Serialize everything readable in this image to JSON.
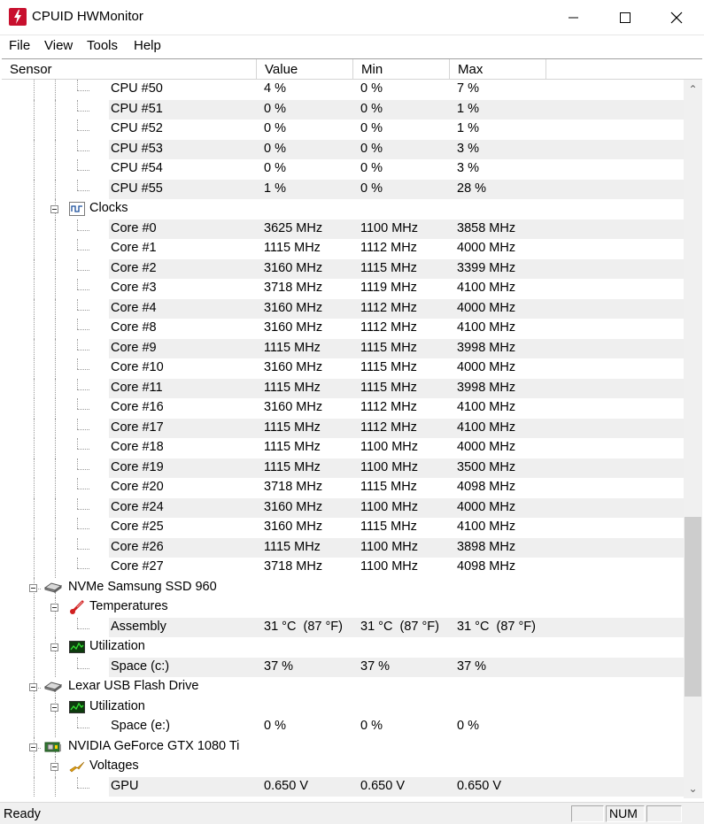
{
  "window": {
    "title": "CPUID HWMonitor"
  },
  "menu": [
    "File",
    "View",
    "Tools",
    "Help"
  ],
  "columns": [
    "Sensor",
    "Value",
    "Min",
    "Max"
  ],
  "tree_rows": [
    {
      "kind": "leaf",
      "name": "CPU #50",
      "value": "4 %",
      "min": "0 %",
      "max": "7 %"
    },
    {
      "kind": "leaf",
      "name": "CPU #51",
      "value": "0 %",
      "min": "0 %",
      "max": "1 %"
    },
    {
      "kind": "leaf",
      "name": "CPU #52",
      "value": "0 %",
      "min": "0 %",
      "max": "1 %"
    },
    {
      "kind": "leaf",
      "name": "CPU #53",
      "value": "0 %",
      "min": "0 %",
      "max": "3 %"
    },
    {
      "kind": "leaf",
      "name": "CPU #54",
      "value": "0 %",
      "min": "0 %",
      "max": "3 %"
    },
    {
      "kind": "leaf",
      "name": "CPU #55",
      "value": "1 %",
      "min": "0 %",
      "max": "28 %"
    },
    {
      "kind": "group",
      "name": "Clocks",
      "icon": "clock-wave-icon"
    },
    {
      "kind": "leaf",
      "name": "Core #0",
      "value": "3625 MHz",
      "min": "1100 MHz",
      "max": "3858 MHz"
    },
    {
      "kind": "leaf",
      "name": "Core #1",
      "value": "1115 MHz",
      "min": "1112 MHz",
      "max": "4000 MHz"
    },
    {
      "kind": "leaf",
      "name": "Core #2",
      "value": "3160 MHz",
      "min": "1115 MHz",
      "max": "3399 MHz"
    },
    {
      "kind": "leaf",
      "name": "Core #3",
      "value": "3718 MHz",
      "min": "1119 MHz",
      "max": "4100 MHz"
    },
    {
      "kind": "leaf",
      "name": "Core #4",
      "value": "3160 MHz",
      "min": "1112 MHz",
      "max": "4000 MHz"
    },
    {
      "kind": "leaf",
      "name": "Core #8",
      "value": "3160 MHz",
      "min": "1112 MHz",
      "max": "4100 MHz"
    },
    {
      "kind": "leaf",
      "name": "Core #9",
      "value": "1115 MHz",
      "min": "1115 MHz",
      "max": "3998 MHz"
    },
    {
      "kind": "leaf",
      "name": "Core #10",
      "value": "3160 MHz",
      "min": "1115 MHz",
      "max": "4000 MHz"
    },
    {
      "kind": "leaf",
      "name": "Core #11",
      "value": "1115 MHz",
      "min": "1115 MHz",
      "max": "3998 MHz"
    },
    {
      "kind": "leaf",
      "name": "Core #16",
      "value": "3160 MHz",
      "min": "1112 MHz",
      "max": "4100 MHz"
    },
    {
      "kind": "leaf",
      "name": "Core #17",
      "value": "1115 MHz",
      "min": "1112 MHz",
      "max": "4100 MHz"
    },
    {
      "kind": "leaf",
      "name": "Core #18",
      "value": "1115 MHz",
      "min": "1100 MHz",
      "max": "4000 MHz"
    },
    {
      "kind": "leaf",
      "name": "Core #19",
      "value": "1115 MHz",
      "min": "1100 MHz",
      "max": "3500 MHz"
    },
    {
      "kind": "leaf",
      "name": "Core #20",
      "value": "3718 MHz",
      "min": "1115 MHz",
      "max": "4098 MHz"
    },
    {
      "kind": "leaf",
      "name": "Core #24",
      "value": "3160 MHz",
      "min": "1100 MHz",
      "max": "4000 MHz"
    },
    {
      "kind": "leaf",
      "name": "Core #25",
      "value": "3160 MHz",
      "min": "1115 MHz",
      "max": "4100 MHz"
    },
    {
      "kind": "leaf",
      "name": "Core #26",
      "value": "1115 MHz",
      "min": "1100 MHz",
      "max": "3898 MHz"
    },
    {
      "kind": "leaf",
      "name": "Core #27",
      "value": "3718 MHz",
      "min": "1100 MHz",
      "max": "4098 MHz"
    },
    {
      "kind": "device",
      "name": "NVMe Samsung SSD 960",
      "icon": "drive-icon"
    },
    {
      "kind": "group",
      "name": "Temperatures",
      "icon": "thermometer-icon"
    },
    {
      "kind": "leaf",
      "name": "Assembly",
      "value": "31 °C  (87 °F)",
      "min": "31 °C  (87 °F)",
      "max": "31 °C  (87 °F)"
    },
    {
      "kind": "group",
      "name": "Utilization",
      "icon": "utilization-monitor-icon"
    },
    {
      "kind": "leaf",
      "name": "Space (c:)",
      "value": "37 %",
      "min": "37 %",
      "max": "37 %"
    },
    {
      "kind": "device",
      "name": "Lexar USB Flash Drive",
      "icon": "drive-icon"
    },
    {
      "kind": "group",
      "name": "Utilization",
      "icon": "utilization-monitor-icon"
    },
    {
      "kind": "leaf",
      "name": "Space (e:)",
      "value": "0 %",
      "min": "0 %",
      "max": "0 %"
    },
    {
      "kind": "device",
      "name": "NVIDIA GeForce GTX 1080 Ti",
      "icon": "gpu-card-icon"
    },
    {
      "kind": "group",
      "name": "Voltages",
      "icon": "voltage-bolt-icon"
    },
    {
      "kind": "leaf",
      "name": "GPU",
      "value": "0.650 V",
      "min": "0.650 V",
      "max": "0.650 V"
    }
  ],
  "statusbar": {
    "text": "Ready",
    "num_indicator": "NUM"
  },
  "colors": {
    "stripe": "#efefef",
    "scrollbar_track": "#f0f0f0",
    "scrollbar_thumb": "#cdcdcd",
    "app_icon": "#c8102e"
  }
}
